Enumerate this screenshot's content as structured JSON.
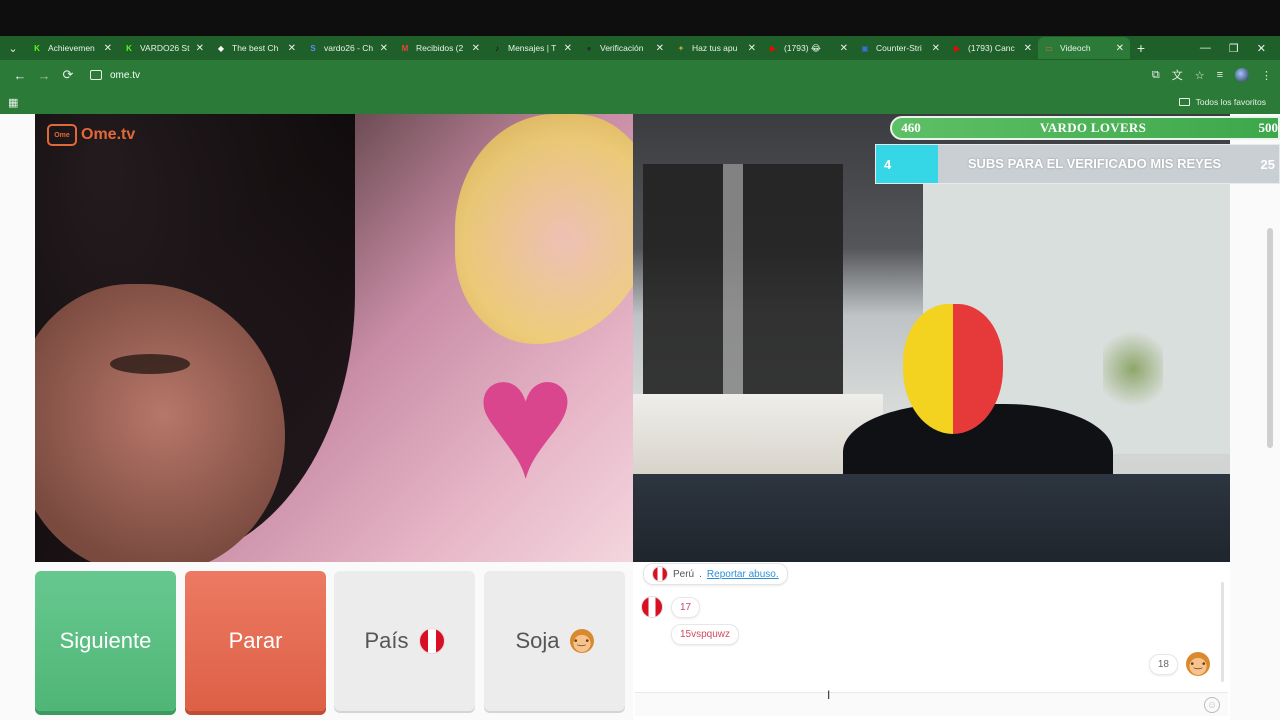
{
  "browser": {
    "tabs": [
      {
        "label": "Achievemen",
        "fav": "K",
        "color": "#53fc18"
      },
      {
        "label": "VARDO26 St",
        "fav": "K",
        "color": "#53fc18"
      },
      {
        "label": "The best Ch",
        "fav": "◆",
        "color": "#ffffff"
      },
      {
        "label": "vardo26 - Ch",
        "fav": "S",
        "color": "#5b8cff"
      },
      {
        "label": "Recibidos (2",
        "fav": "M",
        "color": "#ea4335"
      },
      {
        "label": "Mensajes | T",
        "fav": "♪",
        "color": "#111111"
      },
      {
        "label": "Verificación",
        "fav": "●",
        "color": "#2b2b2b"
      },
      {
        "label": "Haz tus apu",
        "fav": "✦",
        "color": "#c9a23c"
      },
      {
        "label": "(1793) 😂 ",
        "fav": "▶",
        "color": "#ff0000"
      },
      {
        "label": "Counter-Stri",
        "fav": "▣",
        "color": "#3b6fd6"
      },
      {
        "label": "(1793) Canc",
        "fav": "▶",
        "color": "#ff0000"
      },
      {
        "label": "Videoch",
        "fav": "▭",
        "color": "#e2683a"
      }
    ],
    "url": "ome.tv",
    "bookmarks_folder": "Todos los favoritos"
  },
  "logo": {
    "text": "Ome.tv",
    "icon_text": "Ome"
  },
  "overlays": {
    "goal1": {
      "start": "460",
      "title": "VARDO LOVERS",
      "end": "500"
    },
    "goal2": {
      "start": "4",
      "title": "SUBS PARA EL VERIFICADO MIS REYES",
      "end": "25"
    }
  },
  "controls": {
    "next_label": "Siguiente",
    "stop_label": "Parar",
    "country_label": "País",
    "gender_label": "Soja"
  },
  "chat": {
    "top_country": "Perú",
    "report_link": "Reportar abuso.",
    "messages": [
      {
        "text": "17"
      },
      {
        "text": "15vspquwz"
      }
    ],
    "my_message": "18"
  },
  "colors": {
    "next": "#4fb676",
    "stop": "#dd6046",
    "browser_theme": "#2b7a37"
  }
}
